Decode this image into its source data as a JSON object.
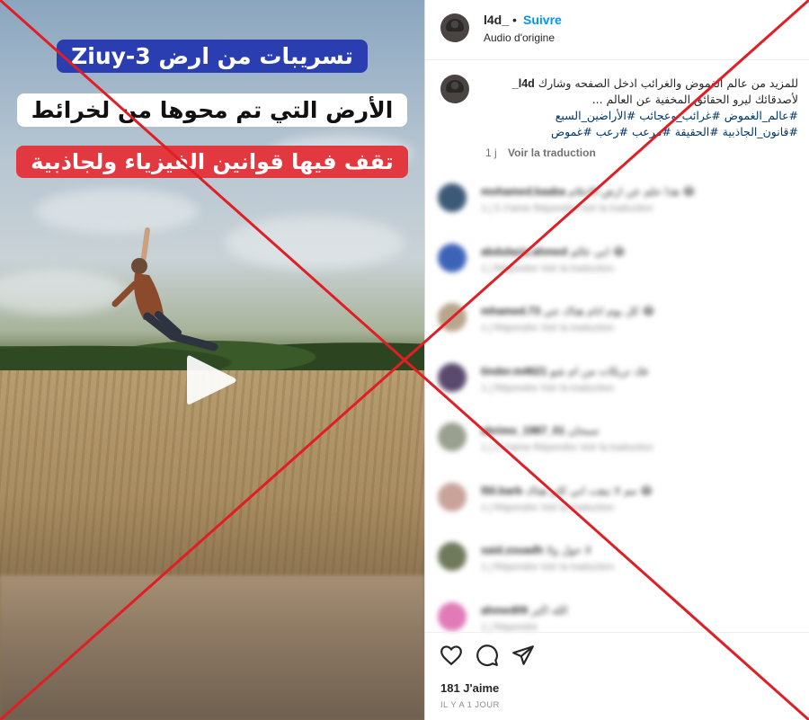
{
  "video": {
    "caption_line1": "تسريبات من ارض Ziuy-3",
    "caption_line2": "الأرض التي تم محوها من لخرائط",
    "caption_line3": "تقف فيها قوانين الفيزياء ولجاذبية"
  },
  "header": {
    "username": "l4d_",
    "dot": "•",
    "follow_label": "Suivre",
    "audio_label": "Audio d'origine"
  },
  "caption_post": {
    "username": "l4d_",
    "text_line1": "للمزيد من عالم الغموض والغرائب ادخل الصفحه وشارك",
    "text_line2": "لأصدقائك ليرو الحقائق المخفية عن العالم ...",
    "hashtags_line1": "#عالم_الغموض #غرائب_وعجائب #الأراضين_السبع",
    "hashtags_line2": "#قانون_الجاذبية #الحقيقة #مرعب #رعب #غموض",
    "age": "1 j",
    "translate_label": "Voir la traduction"
  },
  "comments": [
    {
      "user": "mohamed.kaaba",
      "text": "هذا حلم عن ارض الاحلام 😂",
      "meta": "1 j   3 J'aime   Répondre   Voir la traduction",
      "avatar_color": "#3c5a78"
    },
    {
      "user": "abdulaziz.ahmed",
      "text": "ابي عالم 😂",
      "meta": "1 j   Répondre   Voir la traduction",
      "avatar_color": "#3d63b8"
    },
    {
      "user": "mhamed.73",
      "text": "كل يوم انام هناك جي 😂",
      "meta": "1 j   Répondre   Voir la traduction",
      "avatar_color": "#b8a58c"
    },
    {
      "user": "tinder.m4621",
      "text": "فك تريكات من ام شو",
      "meta": "1 j   Répondre   Voir la traduction",
      "avatar_color": "#5a4a6e"
    },
    {
      "user": "abrimo_1987_01",
      "text": "سبحان",
      "meta": "1 j   1 J'aime   Répondre   Voir la traduction",
      "avatar_color": "#9aa090"
    },
    {
      "user": "l50.barb",
      "text": "مم لا تبقت اني كان هناك 😂",
      "meta": "1 j   Répondre   Voir la traduction",
      "avatar_color": "#c9a39a"
    },
    {
      "user": "said.zouadh",
      "text": "لا حول ولا",
      "meta": "1 j   Répondre   Voir la traduction",
      "avatar_color": "#6f7a5a"
    },
    {
      "user": "ahmed09",
      "text": "الله اكبر",
      "meta": "1 j   Répondre",
      "avatar_color": "#e07bb8"
    }
  ],
  "actions": {
    "likes": "181 J'aime",
    "posted": "IL Y A 1 JOUR"
  },
  "colors": {
    "accent": "#0095f6",
    "cross": "#e01e24",
    "caption_blue": "#2a3eb1",
    "caption_red": "#e2383f"
  }
}
